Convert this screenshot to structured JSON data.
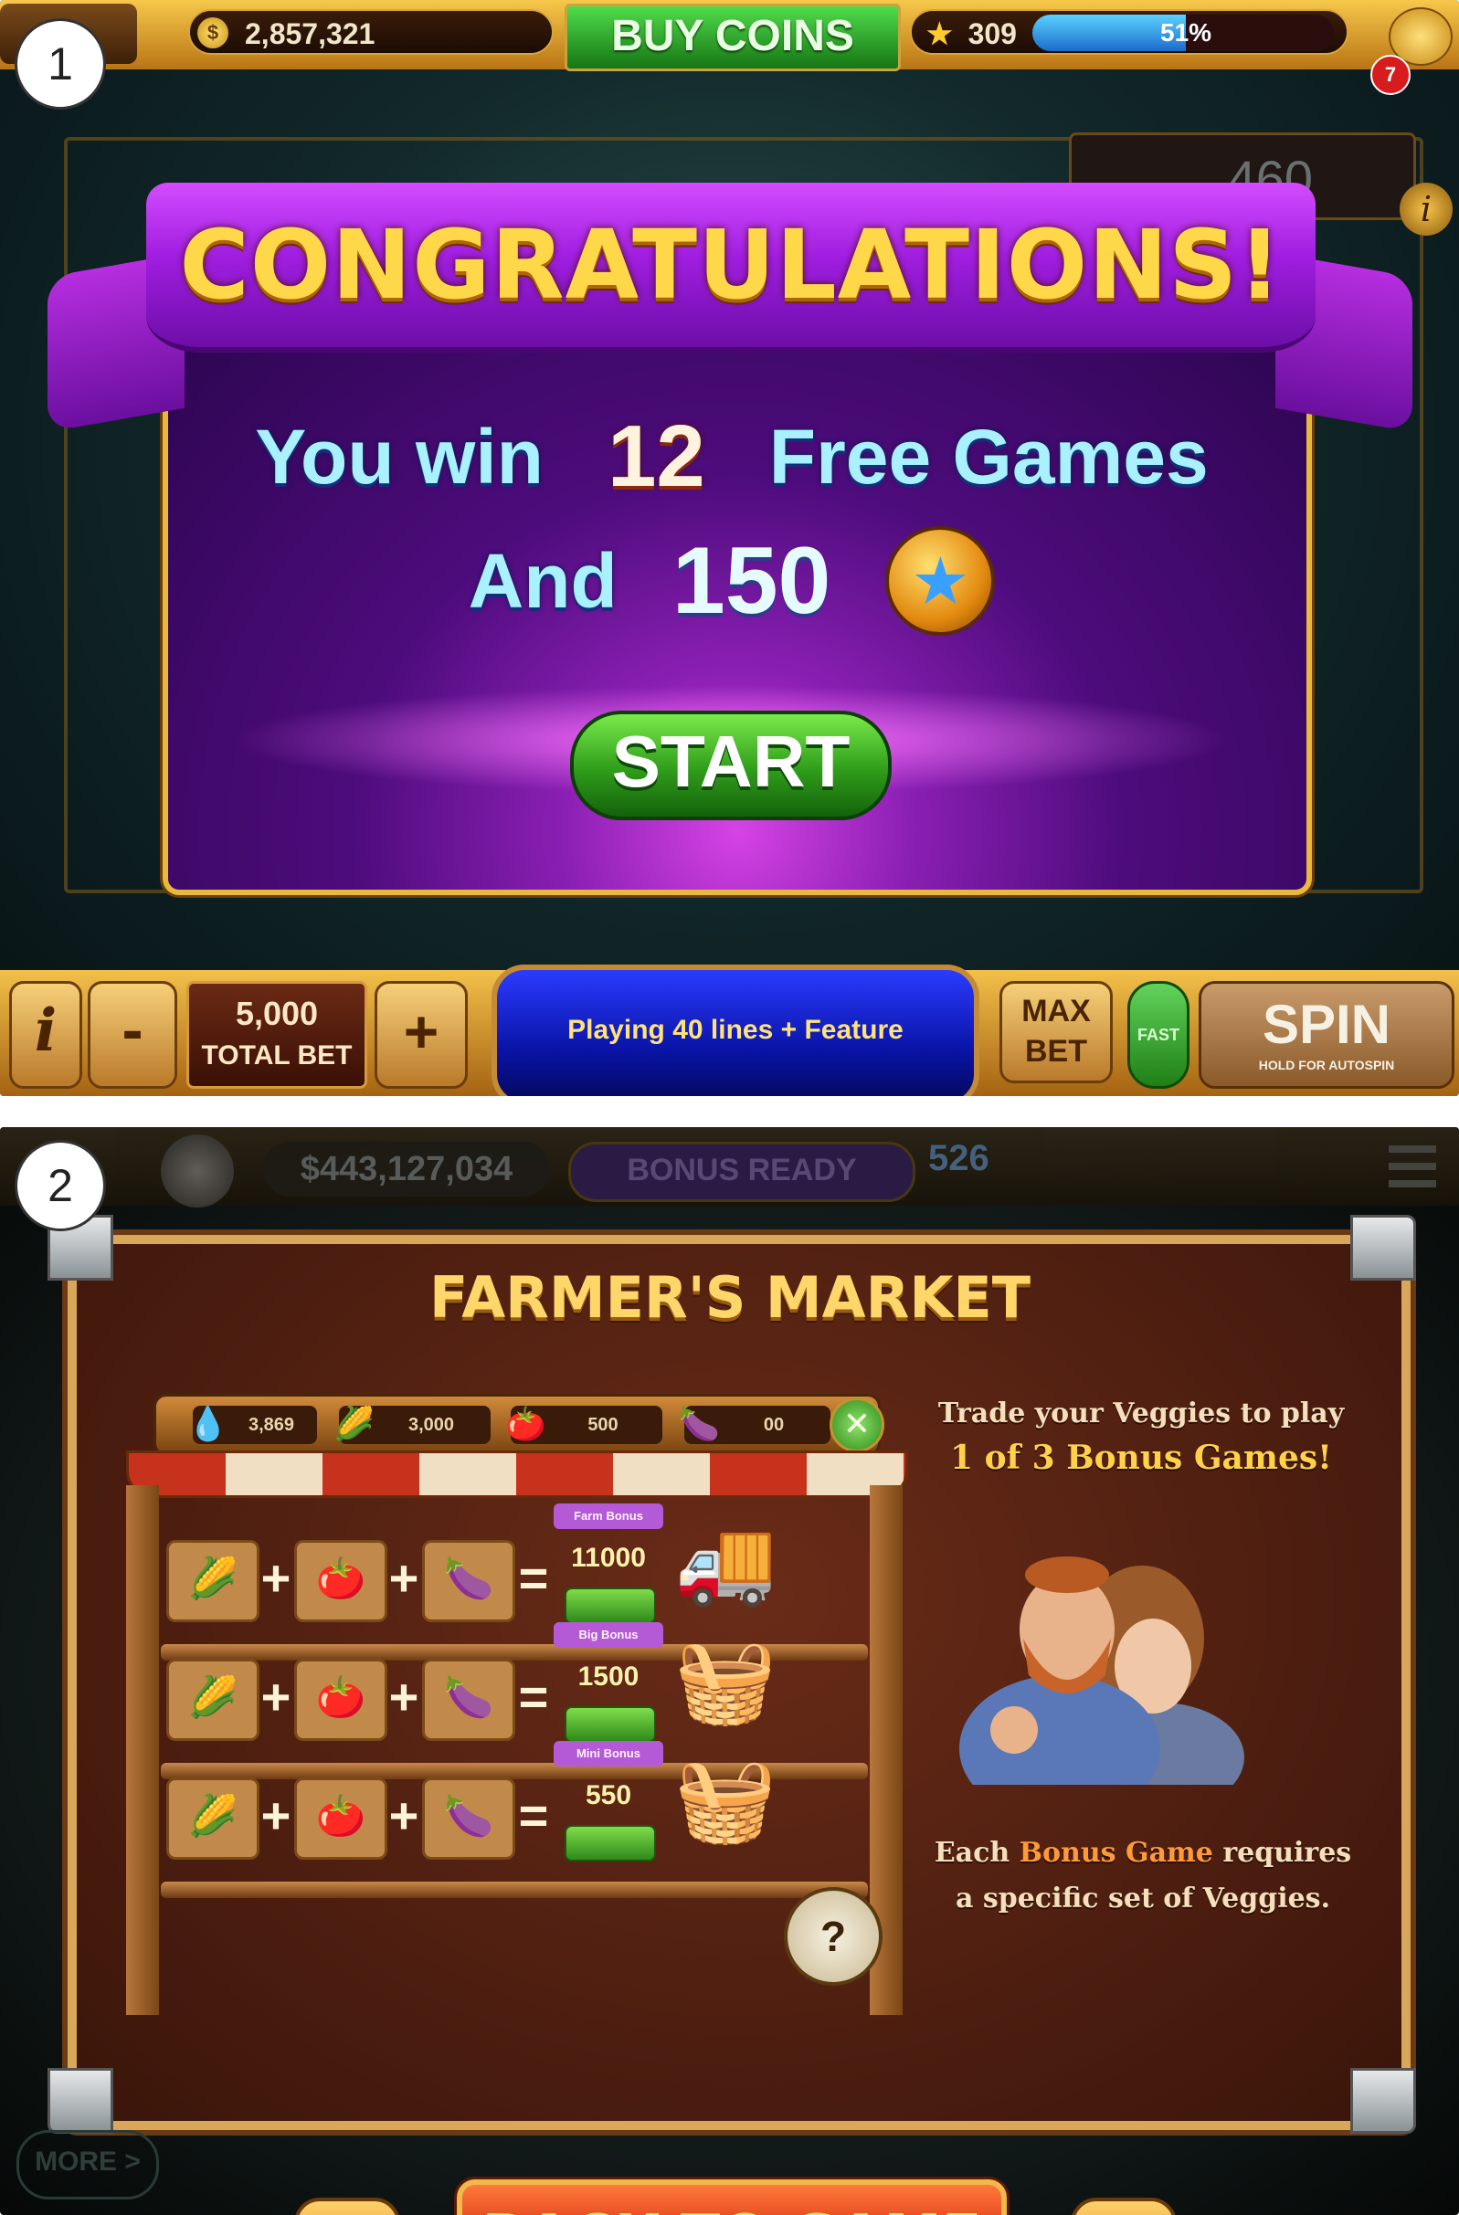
{
  "badges": {
    "first": "1",
    "second": "2"
  },
  "screen1": {
    "coins": "2,857,321",
    "coin_icon": "$",
    "buy_coins_label": "BUY COINS",
    "level_star": "★",
    "level": "309",
    "xp_percent_text": "51%",
    "xp_progress": 0.51,
    "notification_count": "7",
    "background_value": "460",
    "info_glyph": "i",
    "dialog": {
      "title": "CONGRATULATIONS!",
      "you_win": "You win",
      "free_games_count": "12",
      "free_games_label": "Free Games",
      "and_label": "And",
      "bonus_amount": "150",
      "star_icon": "★",
      "start_label": "START"
    },
    "bottom_bar": {
      "info_label": "i",
      "minus_label": "-",
      "total_bet_value": "5,000",
      "total_bet_label": "TOTAL BET",
      "plus_label": "+",
      "status_text": "Playing 40 lines + Feature",
      "max_bet_line1": "MAX",
      "max_bet_line2": "BET",
      "fast_label": "FAST",
      "spin_label": "SPIN",
      "spin_sub_label": "HOLD FOR AUTOSPIN"
    }
  },
  "screen2": {
    "top_bar": {
      "balance": "$443,127,034",
      "bonus_status": "BONUS READY",
      "level_text": "526"
    },
    "market": {
      "title": "FARMER'S MARKET",
      "resources": [
        {
          "icon": "💧",
          "value": "3,869"
        },
        {
          "icon": "🌽",
          "value": "3,000"
        },
        {
          "icon": "🍅",
          "value": "500"
        },
        {
          "icon": "🍆",
          "value": "00"
        }
      ],
      "close_glyph": "✕",
      "rows": [
        {
          "tag": "Farm Bonus",
          "value": "11000",
          "prize_icon": "🚚"
        },
        {
          "tag": "Big Bonus",
          "value": "1500",
          "prize_icon": "🧺"
        },
        {
          "tag": "Mini Bonus",
          "value": "550",
          "prize_icon": "🧺"
        }
      ],
      "crate_icons": [
        "🌽",
        "🍅",
        "🍆"
      ],
      "plus_glyph": "+",
      "equals_glyph": "=",
      "mystery_glyph": "?",
      "side_top_line1": "Trade your Veggies to play",
      "side_top_line2": "1 of 3 Bonus Games!",
      "side_bottom_line1_pre": "Each",
      "side_bottom_highlight": "Bonus Game",
      "side_bottom_line1_post": "requires",
      "side_bottom_line2": "a specific set of Veggies.",
      "back_label": "BACK TO GAME"
    },
    "more_label": "MORE >"
  }
}
